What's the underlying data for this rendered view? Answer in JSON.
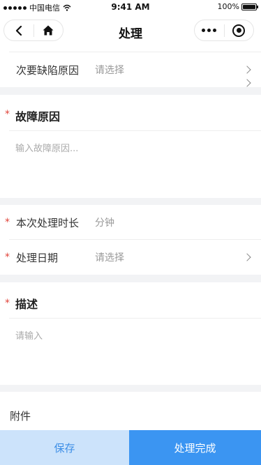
{
  "status_bar": {
    "carrier": "中国电信",
    "time": "9:41 AM",
    "battery": "100%"
  },
  "nav": {
    "title": "处理",
    "icons": [
      "back-arrow-icon",
      "home-icon",
      "more-dots-icon",
      "target-icon"
    ]
  },
  "form": {
    "secondary_cause": {
      "label": "次要缺陷原因",
      "value": "请选择"
    },
    "fault_cause": {
      "label": "故障原因",
      "placeholder": "输入故障原因..."
    },
    "duration": {
      "label": "本次处理时长",
      "placeholder": "分钟"
    },
    "date": {
      "label": "处理日期",
      "value": "请选择"
    },
    "description": {
      "label": "描述",
      "placeholder": "请输入"
    },
    "attachment": {
      "label": "附件"
    },
    "required_mark": "*"
  },
  "buttons": {
    "save": "保存",
    "done": "处理完成"
  },
  "colors": {
    "primary": "#3b95f2",
    "save_bg": "#cce3fb",
    "required": "#e0443a"
  }
}
